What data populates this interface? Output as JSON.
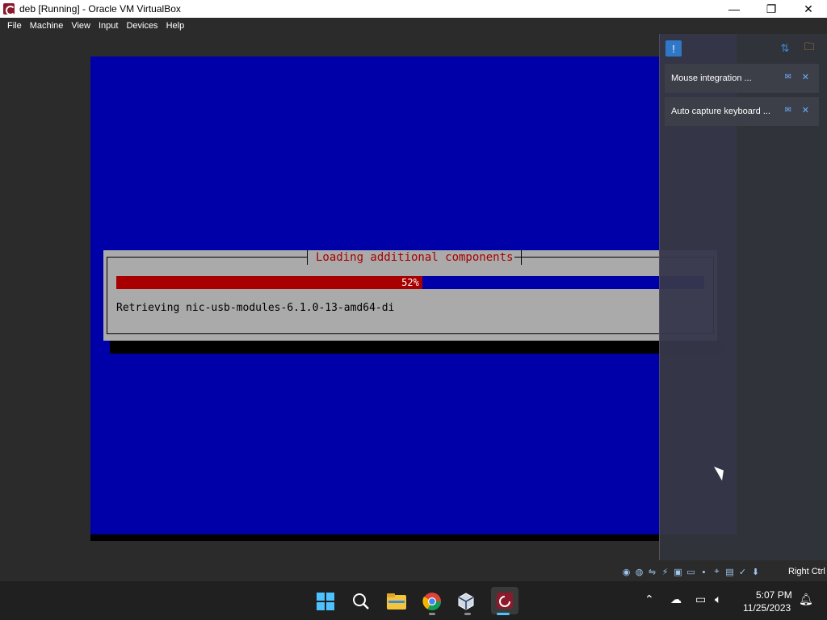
{
  "window": {
    "title": "deb [Running] - Oracle VM VirtualBox",
    "minimize_glyph": "—",
    "maximize_glyph": "❐",
    "close_glyph": "✕"
  },
  "menu": {
    "items": [
      "File",
      "Machine",
      "View",
      "Input",
      "Devices",
      "Help"
    ]
  },
  "installer": {
    "dialog_title": "Loading additional components",
    "progress_percent": 52,
    "progress_label": "52%",
    "status_text": "Retrieving nic-usb-modules-6.1.0-13-amd64-di"
  },
  "notifications": {
    "items": [
      {
        "text": "Mouse integration ..."
      },
      {
        "text": "Auto capture keyboard ..."
      }
    ]
  },
  "statusbar": {
    "host_key": "Right Ctrl",
    "icons": [
      "optical-drive-icon",
      "audio-icon",
      "network-icon",
      "usb-icon",
      "shared-folder-icon",
      "display-icon",
      "recording-icon",
      "mouse-integration-icon",
      "cpu-icon",
      "keyboard-icon",
      "vm-status-icon"
    ]
  },
  "taskbar": {
    "time": "5:07 PM",
    "date": "11/25/2023"
  },
  "colors": {
    "guest_blue": "#0000a8",
    "progress_red": "#a80000",
    "dialog_gray": "#aaaaaa"
  }
}
